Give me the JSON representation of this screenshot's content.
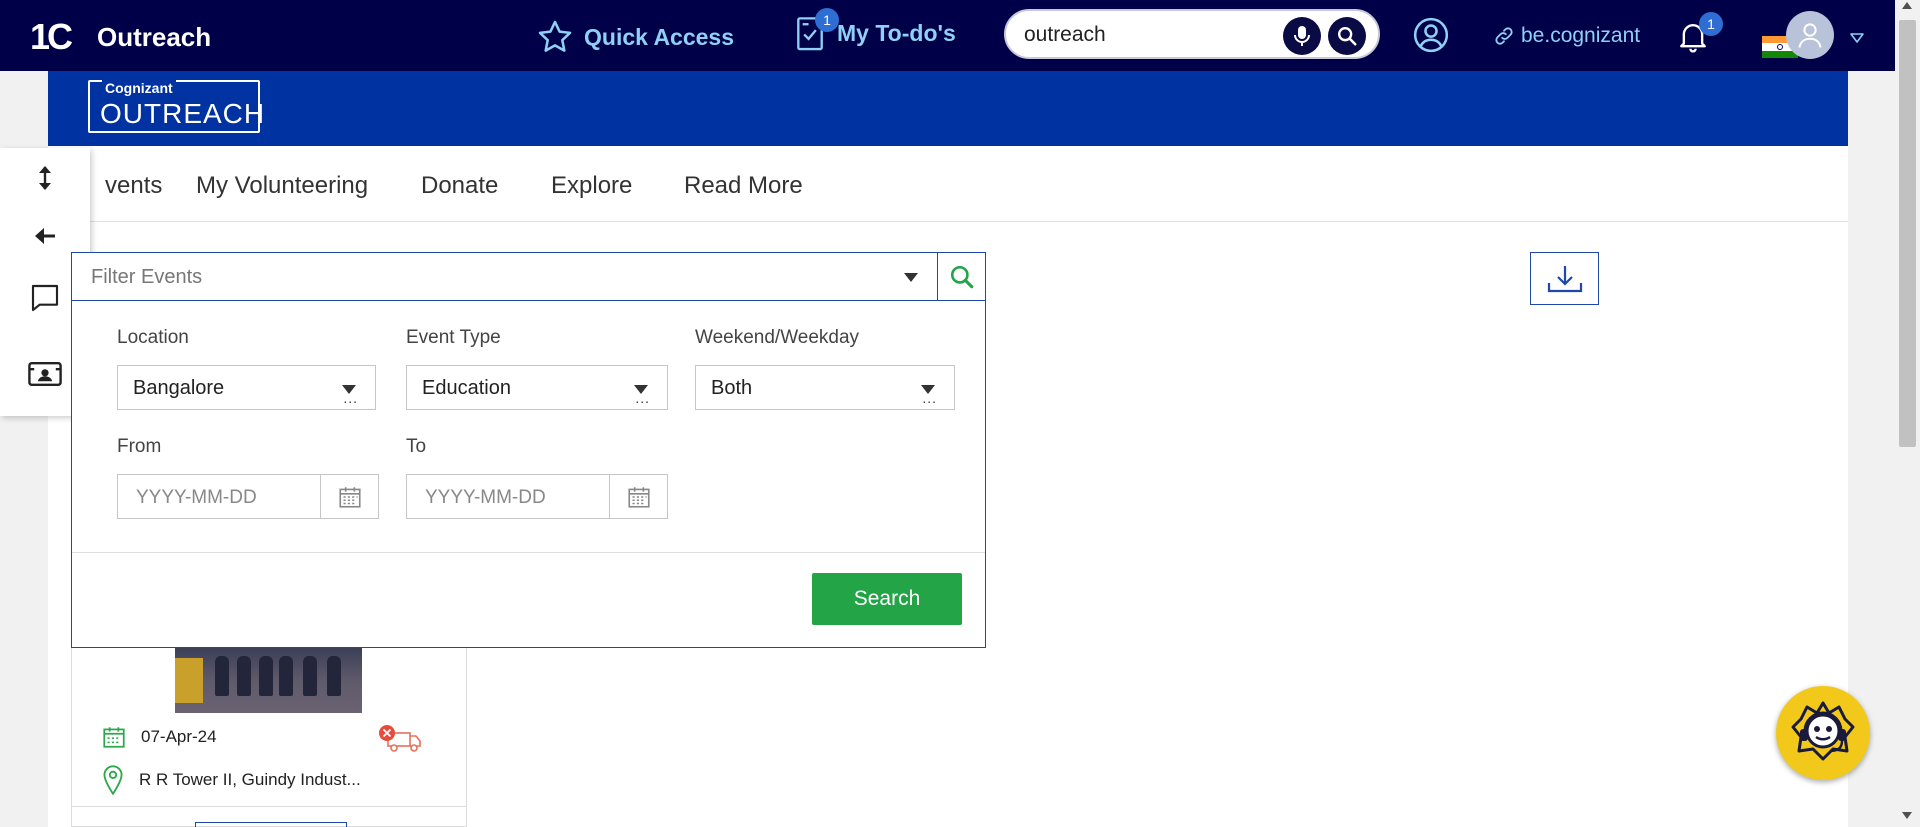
{
  "topbar": {
    "logo": "1C",
    "app_title": "Outreach",
    "quick_access_label": "Quick Access",
    "todo_label": "My To-do's",
    "todo_badge": "1",
    "search_value": "outreach",
    "be_cognizant_label": "be.cognizant",
    "notification_badge": "1",
    "colors": {
      "bar": "#000048",
      "accent": "#8fd0f5",
      "badge": "#2e6dd1"
    }
  },
  "banner": {
    "brand_small": "Cognizant",
    "brand_big": "OUTREACH",
    "color": "#0033a1"
  },
  "nav": {
    "items": [
      "vents",
      "My Volunteering",
      "Donate",
      "Explore",
      "Read More"
    ]
  },
  "side_panel": {
    "icons": [
      "expand-vertical-icon",
      "arrow-left-icon",
      "chat-bubble-icon",
      "contact-card-icon"
    ]
  },
  "filter": {
    "placeholder": "Filter Events",
    "location_label": "Location",
    "location_value": "Bangalore",
    "event_type_label": "Event Type",
    "event_type_value": "Education",
    "weekend_label": "Weekend/Weekday",
    "weekend_value": "Both",
    "from_label": "From",
    "from_placeholder": "YYYY-MM-DD",
    "to_label": "To",
    "to_placeholder": "YYYY-MM-DD",
    "search_button": "Search",
    "button_color": "#23a447"
  },
  "event_card": {
    "date": "07-Apr-24",
    "location": "R R Tower II, Guindy Indust..."
  }
}
